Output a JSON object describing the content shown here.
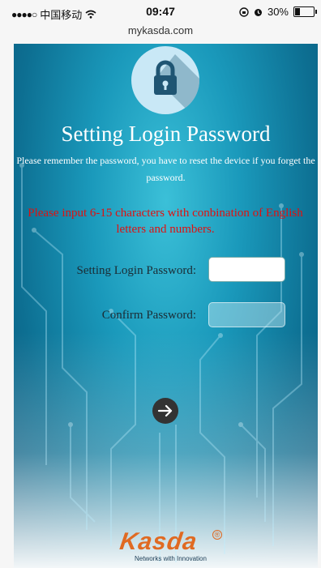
{
  "status_bar": {
    "carrier": "中国移动",
    "time": "09:47",
    "battery": "30%",
    "battery_level": 0.3
  },
  "browser": {
    "url": "mykasda.com"
  },
  "page": {
    "title": "Setting Login Password",
    "notice": "Please remember the password, you have to reset the device if you forget the password.",
    "warning": "Please input 6-15 characters with conbination of English letters and numbers.",
    "fields": [
      {
        "label": "Setting Login Password:",
        "value": ""
      },
      {
        "label": "Confirm Password:",
        "value": ""
      }
    ]
  },
  "logo": {
    "brand": "Kasda",
    "tagline": "Networks with Innovation",
    "registered": "®"
  },
  "icons": {
    "lock": "lock-icon",
    "next": "arrow-right-icon",
    "wifi": "wifi-icon",
    "alarm": "alarm-icon"
  },
  "colors": {
    "warning": "#e01010",
    "brand": "#e06a22",
    "background": "#1a99bb"
  }
}
